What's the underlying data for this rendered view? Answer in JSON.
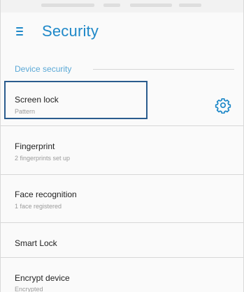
{
  "app_bar": {
    "title": "Security",
    "menu_icon": "hamburger-menu-icon"
  },
  "section": {
    "header": "Device security"
  },
  "items": [
    {
      "title": "Screen lock",
      "summary": "Pattern",
      "action_icon": "gear-icon"
    },
    {
      "title": "Fingerprint",
      "summary": "2 fingerprints set up"
    },
    {
      "title": "Face recognition",
      "summary": "1 face registered"
    },
    {
      "title": "Smart Lock",
      "summary": ""
    },
    {
      "title": "Encrypt device",
      "summary": "Encrypted"
    }
  ],
  "colors": {
    "accent": "#1e88c8",
    "section_header": "#5aa8d6",
    "highlight_border": "#2a5c8e",
    "background": "#fafafa",
    "title_text": "#222222",
    "summary_text": "#9b9b9b"
  }
}
